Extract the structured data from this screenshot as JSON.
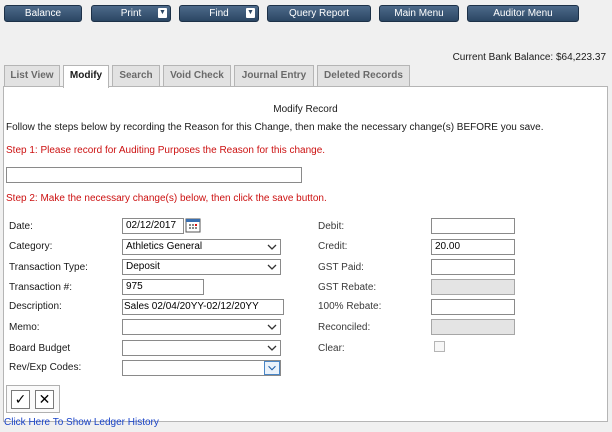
{
  "toolbar": {
    "balance": "Balance",
    "print": "Print",
    "find": "Find",
    "query_report": "Query Report",
    "main_menu": "Main Menu",
    "auditor_menu": "Auditor Menu"
  },
  "bank_balance": "Current Bank Balance: $64,223.37",
  "tabs": [
    "List View",
    "Modify",
    "Search",
    "Void Check",
    "Journal Entry",
    "Deleted Records"
  ],
  "active_tab": "Modify",
  "panel": {
    "title": "Modify Record",
    "instructions": "Follow the steps below by recording the Reason for this Change, then make the necessary change(s) BEFORE you save.",
    "step1": "Step 1: Please record for Auditing Purposes the Reason for this change.",
    "step2": "Step 2: Make the necessary change(s) below, then click the save button.",
    "reason_value": ""
  },
  "form_left": {
    "date_label": "Date:",
    "date_value": "02/12/2017",
    "category_label": "Category:",
    "category_value": "Athletics General",
    "type_label": "Transaction Type:",
    "type_value": "Deposit",
    "number_label": "Transaction #:",
    "number_value": "975",
    "desc_label": "Description:",
    "desc_value": "Sales 02/04/20YY-02/12/20YY",
    "memo_label": "Memo:",
    "memo_value": "",
    "budget_label": "Board Budget",
    "budget_value": "",
    "revexp_label": "Rev/Exp Codes:",
    "revexp_value": ""
  },
  "form_right": {
    "debit_label": "Debit:",
    "debit_value": "",
    "credit_label": "Credit:",
    "credit_value": "20.00",
    "gst_paid_label": "GST Paid:",
    "gst_paid_value": "",
    "gst_rebate_label": "GST Rebate:",
    "gst_rebate_value": "",
    "rebate100_label": "100% Rebate:",
    "rebate100_value": "",
    "reconciled_label": "Reconciled:",
    "reconciled_value": "",
    "clear_label": "Clear:"
  },
  "actions": {
    "save_symbol": "✓",
    "cancel_symbol": "✕"
  },
  "ledger_link": "Click Here To Show Ledger History",
  "icons": {
    "dropdown": "chevron-down-icon",
    "date": "calendar-icon",
    "menu_caret": "caret-down-icon"
  },
  "colors": {
    "toolbar": "#2b4663",
    "step_text": "#cc1111",
    "link": "#1a44c8"
  }
}
